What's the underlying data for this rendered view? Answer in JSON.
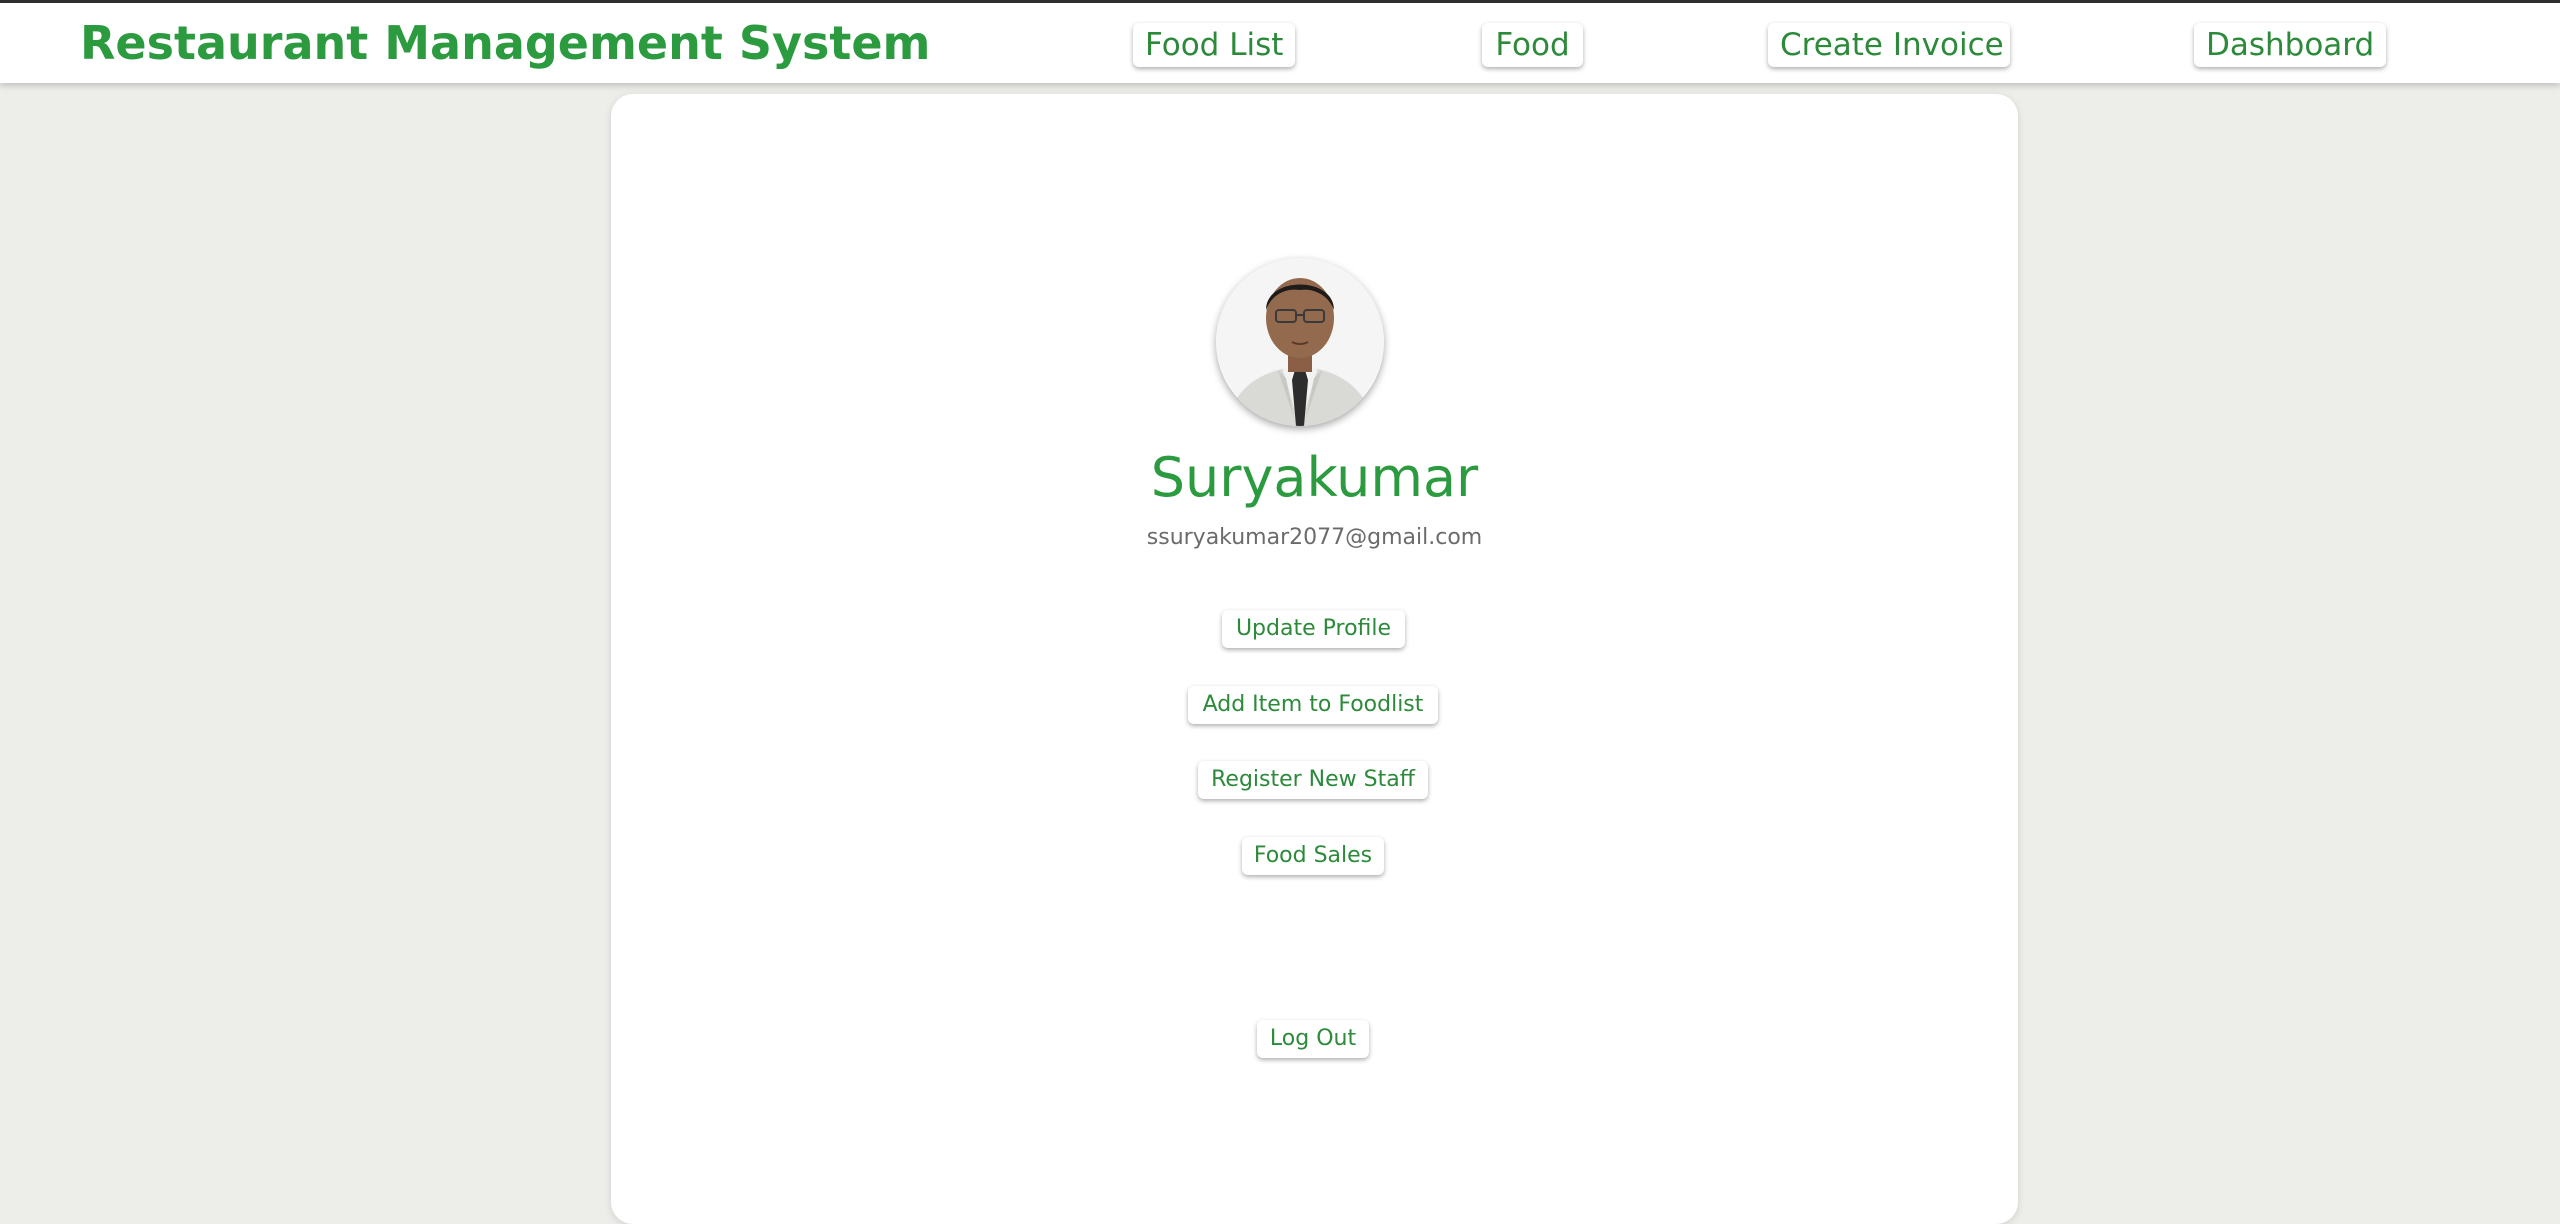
{
  "header": {
    "brand": "Restaurant Management System",
    "nav": [
      {
        "label": "Food List"
      },
      {
        "label": "Food"
      },
      {
        "label": "Create Invoice"
      },
      {
        "label": "Dashboard"
      }
    ]
  },
  "profile": {
    "name": "Suryakumar",
    "email": "ssuryakumar2077@gmail.com",
    "avatar_icon": "user-photo"
  },
  "actions": {
    "update_profile": "Update Profile",
    "add_item": "Add Item to Foodlist",
    "register_staff": "Register New Staff",
    "food_sales": "Food Sales",
    "logout": "Log Out"
  },
  "colors": {
    "accent": "#2c9a3f",
    "background": "#ededea",
    "text_muted": "#6b6b6b"
  }
}
